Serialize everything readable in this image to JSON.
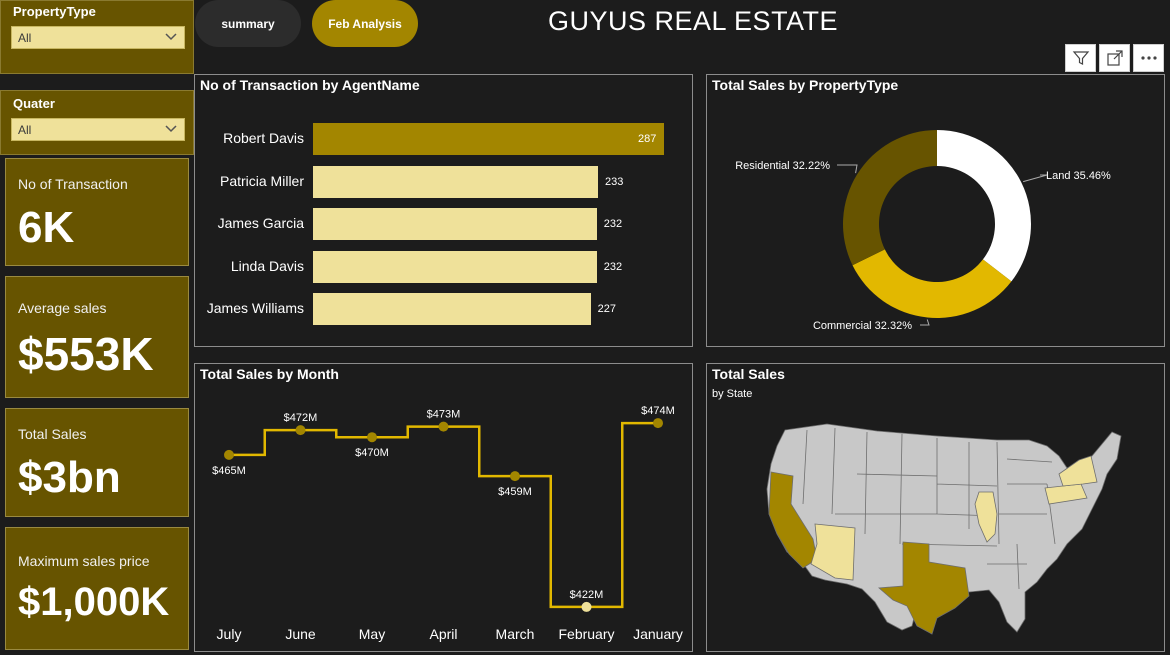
{
  "slicers": {
    "property_type": {
      "label": "PropertyType",
      "value": "All"
    },
    "quater": {
      "label": "Quater",
      "value": "All"
    }
  },
  "kpis": [
    {
      "title": "No of Transaction",
      "value": "6K"
    },
    {
      "title": "Average sales",
      "value": "$553K"
    },
    {
      "title": "Total Sales",
      "value": "$3bn"
    },
    {
      "title": "Maximum sales price",
      "value": "$1,000K"
    }
  ],
  "nav": {
    "summary_label": "summary",
    "feb_label": "Feb Analysis"
  },
  "header": {
    "title": "GUYUS REAL ESTATE"
  },
  "toolbar": {
    "icons": [
      "filter-icon",
      "focus-mode-icon",
      "more-options-icon"
    ]
  },
  "colors": {
    "gold_dark": "#675400",
    "gold": "#a38600",
    "gold_bright": "#e2b800",
    "pale": "#efe19a",
    "bg": "#1c1c1c"
  },
  "panels": {
    "agents_title": "No of Transaction by AgentName",
    "ptype_title": "Total Sales by PropertyType",
    "month_title": "Total Sales by Month",
    "map_title": "Total Sales",
    "map_subtitle": "by State"
  },
  "chart_data": [
    {
      "type": "bar",
      "title": "No of Transaction by AgentName",
      "categories": [
        "Robert Davis",
        "Patricia Miller",
        "James Garcia",
        "Linda Davis",
        "James Williams"
      ],
      "values": [
        287,
        233,
        232,
        232,
        227
      ],
      "labels": [
        "287",
        "233",
        "232",
        "232",
        "227"
      ],
      "orientation": "horizontal"
    },
    {
      "type": "pie",
      "title": "Total Sales by PropertyType",
      "categories": [
        "Land",
        "Commercial",
        "Residential"
      ],
      "values": [
        35.46,
        32.32,
        32.22
      ],
      "labels": [
        "Land 35.46%",
        "Commercial 32.32%",
        "Residential 32.22%"
      ],
      "colors": [
        "#ffffff",
        "#e2b800",
        "#675400"
      ],
      "donut": true
    },
    {
      "type": "line",
      "title": "Total Sales by Month",
      "categories": [
        "July",
        "June",
        "May",
        "April",
        "March",
        "February",
        "January"
      ],
      "values": [
        465,
        472,
        470,
        473,
        459,
        422,
        474
      ],
      "labels": [
        "$465M",
        "$472M",
        "$470M",
        "$473M",
        "$459M",
        "$422M",
        "$474M"
      ],
      "ylim": [
        420,
        476
      ],
      "step": true
    }
  ],
  "map": {
    "highlighted_states": [
      {
        "state": "Texas",
        "color": "#a38600"
      },
      {
        "state": "California",
        "color": "#a38600"
      },
      {
        "state": "Arizona",
        "color": "#efe19a"
      },
      {
        "state": "New York",
        "color": "#efe19a"
      },
      {
        "state": "Pennsylvania",
        "color": "#efe19a"
      },
      {
        "state": "Illinois",
        "color": "#efe19a"
      }
    ]
  }
}
